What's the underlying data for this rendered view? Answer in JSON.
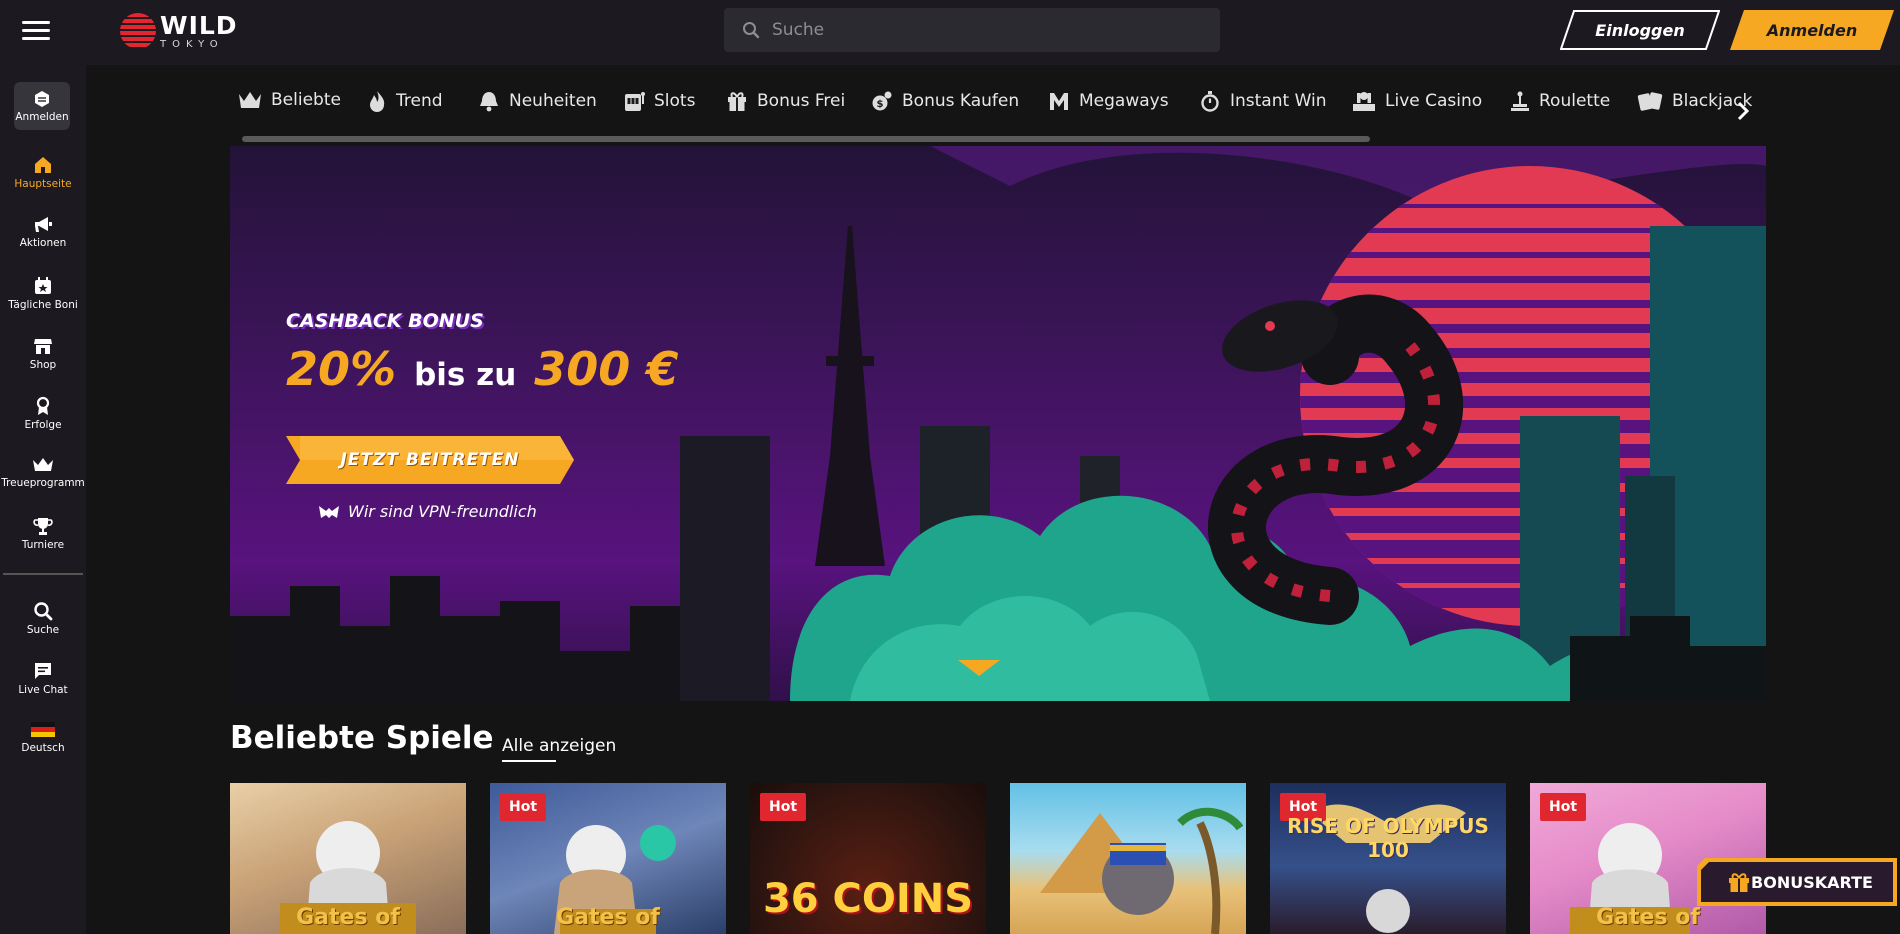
{
  "brand": {
    "name_top": "WILD",
    "name_bottom": "TOKYO"
  },
  "header": {
    "search_placeholder": "Suche",
    "login_label": "Einloggen",
    "register_label": "Anmelden"
  },
  "sidebar": {
    "login_label": "Anmelden",
    "items": [
      {
        "label": "Hauptseite",
        "icon": "home-icon",
        "active": true
      },
      {
        "label": "Aktionen",
        "icon": "megaphone-icon"
      },
      {
        "label": "Tägliche Boni",
        "icon": "calendar-star-icon"
      },
      {
        "label": "Shop",
        "icon": "shop-icon"
      },
      {
        "label": "Erfolge",
        "icon": "medal-icon"
      },
      {
        "label": "Treueprogramm",
        "icon": "crown-icon"
      },
      {
        "label": "Turniere",
        "icon": "trophy-icon"
      },
      {
        "label": "Suche",
        "icon": "search-icon"
      },
      {
        "label": "Live Chat",
        "icon": "chat-icon"
      },
      {
        "label": "Deutsch",
        "icon": "germany-flag-icon"
      }
    ]
  },
  "categories": [
    {
      "label": "Beliebte",
      "icon": "crown-icon"
    },
    {
      "label": "Trend",
      "icon": "flame-icon"
    },
    {
      "label": "Neuheiten",
      "icon": "bell-icon"
    },
    {
      "label": "Slots",
      "icon": "slot-machine-icon"
    },
    {
      "label": "Bonus Frei",
      "icon": "gift-icon"
    },
    {
      "label": "Bonus Kaufen",
      "icon": "coin-icon"
    },
    {
      "label": "Megaways",
      "icon": "m-icon"
    },
    {
      "label": "Instant Win",
      "icon": "stopwatch-icon"
    },
    {
      "label": "Live Casino",
      "icon": "dealer-icon"
    },
    {
      "label": "Roulette",
      "icon": "roulette-icon"
    },
    {
      "label": "Blackjack",
      "icon": "cards-icon"
    }
  ],
  "hero": {
    "kicker": "CASHBACK BONUS",
    "percent": "20%",
    "upto": "bis zu",
    "max": "300 €",
    "cta": "JETZT BEITRETEN",
    "vpn": "Wir sind VPN-freundlich"
  },
  "popular": {
    "title": "Beliebte Spiele",
    "show_all": "Alle anzeigen",
    "games": [
      {
        "caption": "Gates of",
        "badge": ""
      },
      {
        "caption": "Gates of",
        "badge": "Hot"
      },
      {
        "caption": "36 COINS",
        "badge": "Hot"
      },
      {
        "caption": "",
        "badge": ""
      },
      {
        "caption": "RISE OF OLYMPUS 100",
        "badge": "Hot"
      },
      {
        "caption": "Gates of",
        "badge": "Hot"
      }
    ]
  },
  "floating": {
    "bonus_label": "BONUSKARTE"
  },
  "colors": {
    "accent": "#f7a823",
    "hot": "#e0262f",
    "sidebar_bg": "#1c1a20",
    "page_bg": "#141414"
  }
}
